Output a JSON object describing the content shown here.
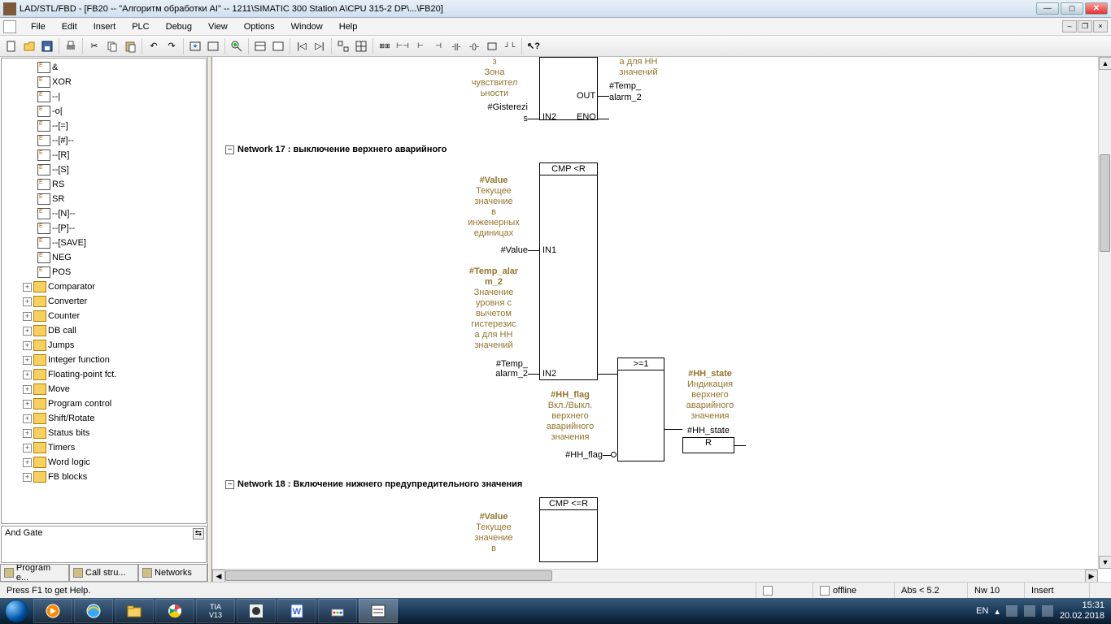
{
  "titlebar": {
    "title": "LAD/STL/FBD  - [FB20 -- \"Алгоритм обработки AI\" -- 1211\\SIMATIC 300 Station A\\CPU 315-2 DP\\...\\FB20]"
  },
  "menubar": {
    "items": [
      "File",
      "Edit",
      "Insert",
      "PLC",
      "Debug",
      "View",
      "Options",
      "Window",
      "Help"
    ]
  },
  "tree": {
    "items": [
      {
        "label": "&",
        "icon": "block",
        "depth": 2
      },
      {
        "label": "XOR",
        "icon": "block",
        "depth": 2
      },
      {
        "label": "--|",
        "icon": "block",
        "depth": 2
      },
      {
        "label": "-o|",
        "icon": "block",
        "depth": 2
      },
      {
        "label": "--[=]",
        "icon": "block",
        "depth": 2
      },
      {
        "label": "--[#]--",
        "icon": "block",
        "depth": 2
      },
      {
        "label": "--[R]",
        "icon": "block",
        "depth": 2
      },
      {
        "label": "--[S]",
        "icon": "block",
        "depth": 2
      },
      {
        "label": "RS",
        "icon": "block",
        "depth": 2
      },
      {
        "label": "SR",
        "icon": "block",
        "depth": 2
      },
      {
        "label": "--[N]--",
        "icon": "block",
        "depth": 2
      },
      {
        "label": "--[P]--",
        "icon": "block",
        "depth": 2
      },
      {
        "label": "--[SAVE]",
        "icon": "block",
        "depth": 2
      },
      {
        "label": "NEG",
        "icon": "block",
        "depth": 2
      },
      {
        "label": "POS",
        "icon": "block",
        "depth": 2
      },
      {
        "label": "Comparator",
        "icon": "folder",
        "depth": 1,
        "exp": "+"
      },
      {
        "label": "Converter",
        "icon": "folder",
        "depth": 1,
        "exp": "+"
      },
      {
        "label": "Counter",
        "icon": "folder",
        "depth": 1,
        "exp": "+"
      },
      {
        "label": "DB call",
        "icon": "folder",
        "depth": 1,
        "exp": "+"
      },
      {
        "label": "Jumps",
        "icon": "folder",
        "depth": 1,
        "exp": "+"
      },
      {
        "label": "Integer function",
        "icon": "folder",
        "depth": 1,
        "exp": "+"
      },
      {
        "label": "Floating-point fct.",
        "icon": "folder",
        "depth": 1,
        "exp": "+"
      },
      {
        "label": "Move",
        "icon": "folder",
        "depth": 1,
        "exp": "+"
      },
      {
        "label": "Program control",
        "icon": "folder",
        "depth": 1,
        "exp": "+"
      },
      {
        "label": "Shift/Rotate",
        "icon": "folder",
        "depth": 1,
        "exp": "+"
      },
      {
        "label": "Status bits",
        "icon": "folder",
        "depth": 1,
        "exp": "+"
      },
      {
        "label": "Timers",
        "icon": "folder",
        "depth": 1,
        "exp": "+"
      },
      {
        "label": "Word logic",
        "icon": "folder",
        "depth": 1,
        "exp": "+"
      },
      {
        "label": "FB blocks",
        "icon": "folder",
        "depth": 1,
        "exp": "+"
      }
    ],
    "desc": "And Gate"
  },
  "tabs": {
    "items": [
      "Program e...",
      "Call stru...",
      "Networks"
    ]
  },
  "networks": {
    "partial_top": {
      "comment1_lines": [
        "з",
        "Зона",
        "чувствител",
        "ьности"
      ],
      "sig1": "#Gisterezi",
      "sig1b": "s",
      "pin_in2": "IN2",
      "pin_eno": "ENO",
      "pin_out": "OUT",
      "comment2_lines": [
        "а для HH",
        "значений"
      ],
      "sig2_a": "#Temp_",
      "sig2_b": "alarm_2"
    },
    "n17": {
      "header": "Network 17 : выключение верхнего аварийного",
      "cmp_title": "CMP <R",
      "in1_label_title": "#Value",
      "in1_label_lines": [
        "Текущее",
        "значение",
        "в",
        "инженерных",
        "единицах"
      ],
      "in1_sig": "#Value",
      "in1_pin": "IN1",
      "in2_label_title": "#Temp_alar",
      "in2_label_title2": "m_2",
      "in2_label_lines": [
        "Значение",
        "уровня с",
        "вычетом",
        "гистерезис",
        "а для HH",
        "значений"
      ],
      "in2_sig_a": "#Temp_",
      "in2_sig_b": "alarm_2",
      "in2_pin": "IN2",
      "or_title": ">=1",
      "hhflag_title": "#HH_flag",
      "hhflag_lines": [
        "Вкл./Выкл.",
        "верхнего",
        "аварийного",
        "значения"
      ],
      "hhflag_sig": "#HH_flag",
      "hhstate_title": "#HH_state",
      "hhstate_lines": [
        "Индикация",
        "верхнего",
        "аварийного",
        "значения"
      ],
      "hhstate_sig": "#HH_state",
      "r_label": "R"
    },
    "n18": {
      "header": "Network 18 : Включение нижнего предупредительного значения",
      "cmp_title": "CMP <=R",
      "in1_label_title": "#Value",
      "in1_label_lines": [
        "Текущее",
        "значение",
        "в"
      ]
    }
  },
  "statusbar": {
    "help": "Press F1 to get Help.",
    "offline": "offline",
    "abs": "Abs < 5.2",
    "nw": "Nw 10",
    "ins": "Insert"
  },
  "taskbar": {
    "lang": "EN",
    "time": "15:31",
    "date": "20.02.2018"
  }
}
